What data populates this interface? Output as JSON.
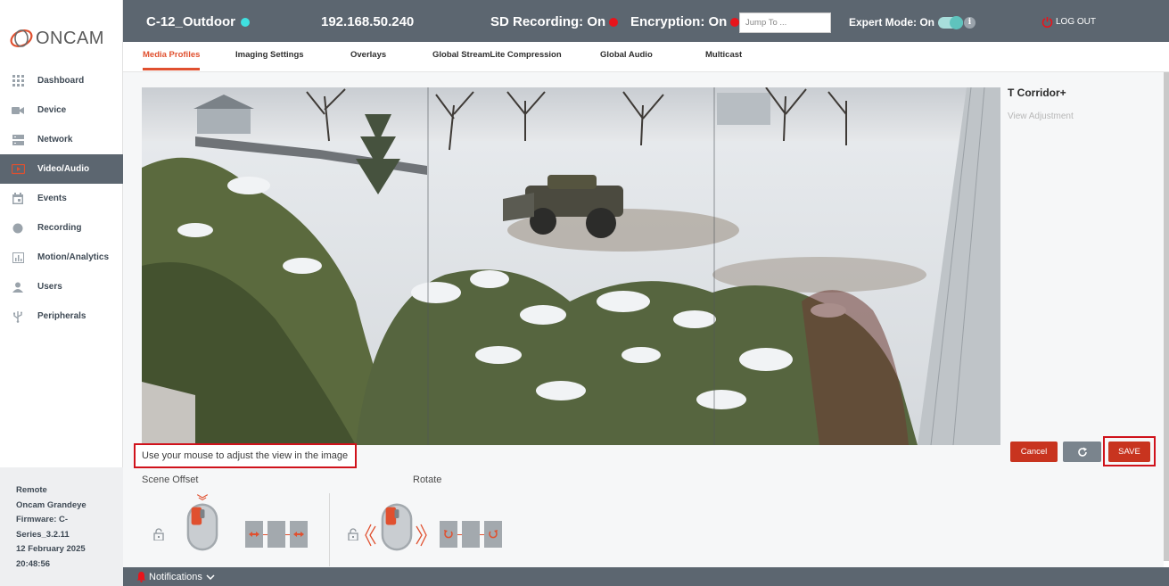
{
  "brand": {
    "name": "ONCAM"
  },
  "sidebar": {
    "items": [
      {
        "label": "Dashboard",
        "icon": "grid-icon",
        "active": false
      },
      {
        "label": "Device",
        "icon": "camera-icon",
        "active": false
      },
      {
        "label": "Network",
        "icon": "server-icon",
        "active": false
      },
      {
        "label": "Video/Audio",
        "icon": "play-screen-icon",
        "active": true
      },
      {
        "label": "Events",
        "icon": "calendar-icon",
        "active": false
      },
      {
        "label": "Recording",
        "icon": "record-dot-icon",
        "active": false
      },
      {
        "label": "Motion/Analytics",
        "icon": "bar-chart-icon",
        "active": false
      },
      {
        "label": "Users",
        "icon": "user-icon",
        "active": false
      },
      {
        "label": "Peripherals",
        "icon": "usb-icon",
        "active": false
      }
    ],
    "footer": {
      "line1": "Remote",
      "line2": "Oncam Grandeye",
      "line3": "Firmware: C-",
      "line4": "Series_3.2.11",
      "line5": "12 February 2025",
      "line6": "20:48:56"
    }
  },
  "header": {
    "device_name": "C-12_Outdoor",
    "ip": "192.168.50.240",
    "sd_recording": "SD Recording: On",
    "encryption": "Encryption: On",
    "jump_placeholder": "Jump To ...",
    "expert_mode": "Expert Mode: On",
    "logout": "LOG OUT",
    "colors": {
      "status_online": "#3fe0e0",
      "status_on": "#e8141b",
      "accent": "#e0502f"
    }
  },
  "tabs": [
    {
      "label": "Media Profiles",
      "active": true
    },
    {
      "label": "Imaging Settings",
      "active": false
    },
    {
      "label": "Overlays",
      "active": false
    },
    {
      "label": "Global StreamLite Compression",
      "active": false
    },
    {
      "label": "Global Audio",
      "active": false
    },
    {
      "label": "Multicast",
      "active": false
    }
  ],
  "profile": {
    "title": "T Corridor+",
    "subtitle": "View Adjustment"
  },
  "actions": {
    "cancel": "Cancel",
    "save": "SAVE"
  },
  "hint": "Use your mouse to adjust the view in the image",
  "controls": {
    "scene_offset": "Scene Offset",
    "rotate": "Rotate"
  },
  "notifications": {
    "label": "Notifications"
  }
}
